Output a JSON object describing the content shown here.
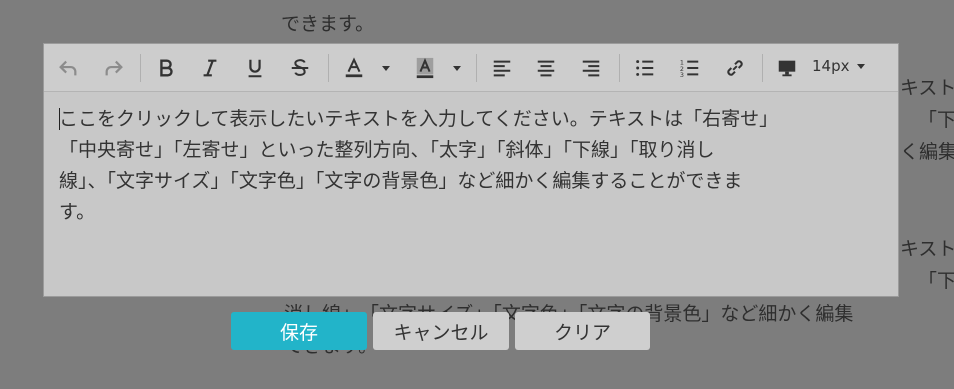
{
  "background": {
    "line1": "できます。",
    "fragment_a1": "キスト",
    "fragment_a2": "「下",
    "fragment_a3": "く編集",
    "fragment_b1": "キスト",
    "fragment_b2": "「下",
    "fragment_b3": "消し線」、「文字サイズ」「文字色」「文字の背景色」など細かく編集",
    "fragment_b4": "できます。"
  },
  "toolbar": {
    "font_size": "14px",
    "icons": [
      "undo-icon",
      "redo-icon",
      "bold-icon",
      "italic-icon",
      "underline-icon",
      "strikethrough-icon",
      "text-color-icon",
      "bg-color-icon",
      "align-left-icon",
      "align-center-icon",
      "align-right-icon",
      "bullet-list-icon",
      "numbered-list-icon",
      "link-icon",
      "device-icon"
    ]
  },
  "editor": {
    "line1": "ここをクリックして表示したいテキストを入力してください。テキストは「右寄せ」",
    "line2": "「中央寄せ」「左寄せ」といった整列方向、「太字」「斜体」「下線」「取り消し",
    "line3": "線」、「文字サイズ」「文字色」「文字の背景色」など細かく編集することができま",
    "line4": "す。"
  },
  "buttons": {
    "save": "保存",
    "cancel": "キャンセル",
    "clear": "クリア"
  },
  "colors": {
    "overlay": "#7d7d7d",
    "editor_bg": "#c8c8c8",
    "save_button": "#22b4c9"
  }
}
